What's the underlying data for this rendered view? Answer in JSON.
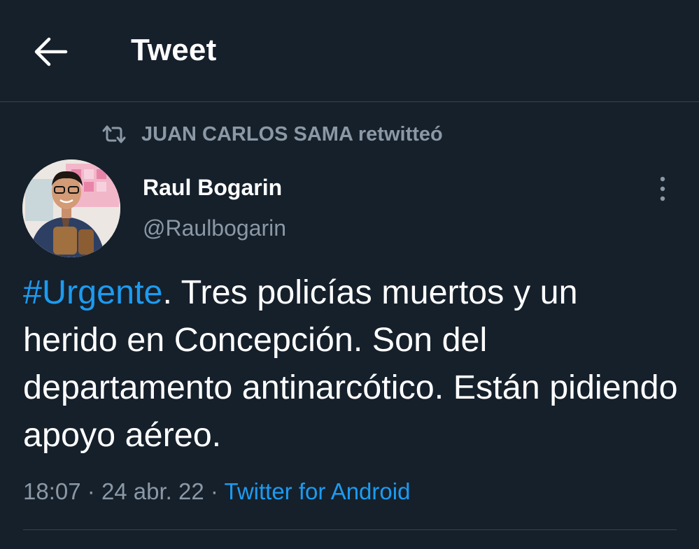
{
  "header": {
    "title": "Tweet",
    "back_icon": "arrow-left-icon"
  },
  "retweet": {
    "icon": "retweet-icon",
    "text": "JUAN CARLOS SAMA retwitteó"
  },
  "author": {
    "display_name": "Raul Bogarin",
    "handle": "@Raulbogarin",
    "more_icon": "more-vertical-icon"
  },
  "tweet": {
    "hashtag": "#Urgente",
    "body": ". Tres policías muertos y un herido en Concepción. Son del departamento antinarcótico. Están pidiendo apoyo aéreo."
  },
  "meta": {
    "time": "18:07",
    "separator": "·",
    "date": "24 abr. 22",
    "source": "Twitter for Android"
  },
  "colors": {
    "background": "#15202b",
    "accent": "#1d9bf0",
    "secondary_text": "#8b98a5",
    "divider": "#38444d"
  }
}
